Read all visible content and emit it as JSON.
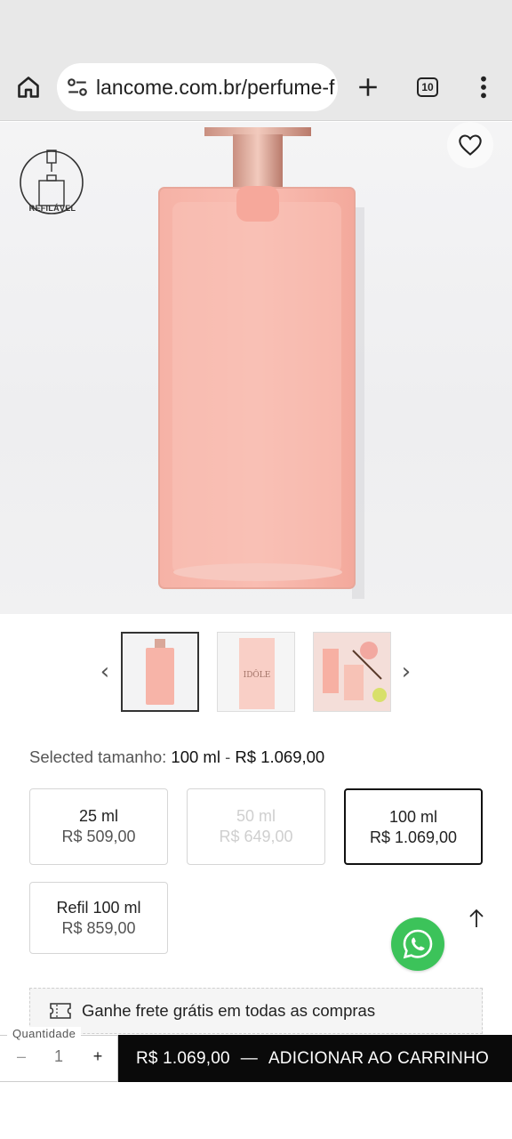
{
  "browser": {
    "url": "lancome.com.br/perfume-f",
    "tab_count": "10"
  },
  "product": {
    "badge_text": "REFILÁVEL"
  },
  "selection": {
    "prefix": "Selected tamanho: ",
    "size": "100 ml",
    "separator": " - ",
    "price": "R$ 1.069,00"
  },
  "sizes": [
    {
      "name": "25 ml",
      "price": "R$ 509,00",
      "state": "available"
    },
    {
      "name": "50 ml",
      "price": "R$ 649,00",
      "state": "unavailable"
    },
    {
      "name": "100 ml",
      "price": "R$ 1.069,00",
      "state": "selected"
    },
    {
      "name": "Refil 100 ml",
      "price": "R$ 859,00",
      "state": "available"
    }
  ],
  "shipping": {
    "text": "Ganhe frete grátis em todas as compras"
  },
  "cart": {
    "qty_label": "Quantidade",
    "qty_minus": "–",
    "qty_value": "1",
    "qty_plus": "+",
    "price": "R$ 1.069,00",
    "separator": "—",
    "action": "ADICIONAR AO CARRINHO"
  },
  "colors": {
    "whatsapp": "#3cc35a",
    "cta_bg": "#0a0a0a",
    "bottle_pink": "#f7b3a8"
  }
}
